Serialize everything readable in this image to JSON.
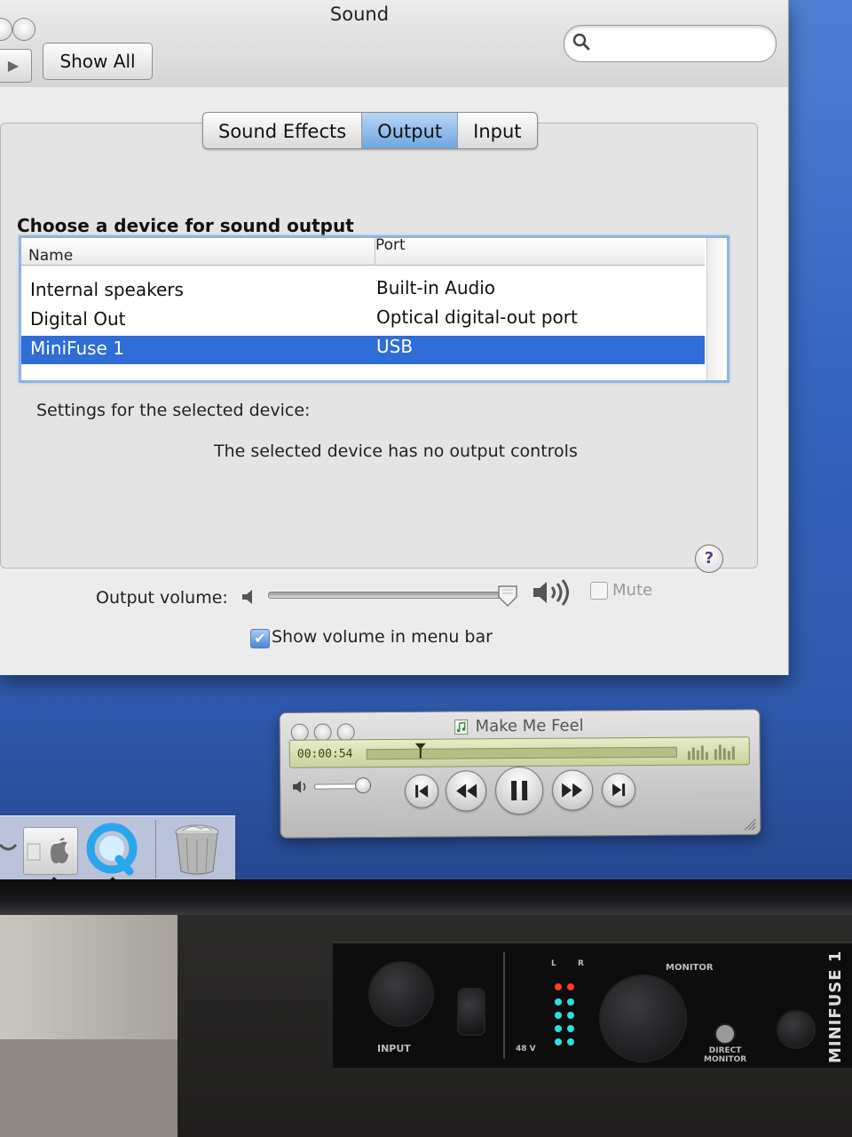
{
  "window": {
    "title": "Sound",
    "show_all_label": "Show All",
    "search_placeholder": ""
  },
  "tabs": [
    {
      "label": "Sound Effects",
      "active": false
    },
    {
      "label": "Output",
      "active": true
    },
    {
      "label": "Input",
      "active": false
    }
  ],
  "output": {
    "heading": "Choose a device for sound output",
    "columns": {
      "name": "Name",
      "port": "Port"
    },
    "devices": [
      {
        "name": "Internal speakers",
        "port": "Built-in Audio",
        "selected": false
      },
      {
        "name": "Digital Out",
        "port": "Optical digital-out port",
        "selected": false
      },
      {
        "name": "MiniFuse 1",
        "port": "USB",
        "selected": true
      }
    ],
    "settings_label": "Settings for the selected device:",
    "no_controls_message": "The selected device has no output controls",
    "help_label": "?"
  },
  "volume": {
    "label": "Output volume:",
    "level": 0.97,
    "mute_label": "Mute",
    "mute_checked": false,
    "mute_enabled": false,
    "menu_bar_label": "Show volume in menu bar",
    "menu_bar_checked": true
  },
  "player": {
    "title": "Make Me Feel",
    "time": "00:00:54",
    "progress": 0.18,
    "volume_level": 0.85
  },
  "hardware": {
    "input_label": "INPUT",
    "phantom_label": "48 V",
    "monitor_label": "MONITOR",
    "direct_monitor_label": "DIRECT\nMONITOR",
    "brand_label": "MINIFUSE 1",
    "meter_left": "L",
    "meter_right": "R"
  },
  "colors": {
    "selection": "#2f6dd7",
    "active_tab": "#6fa5e0",
    "desktop": "#3666bf",
    "lcd": "#c9d29f"
  }
}
